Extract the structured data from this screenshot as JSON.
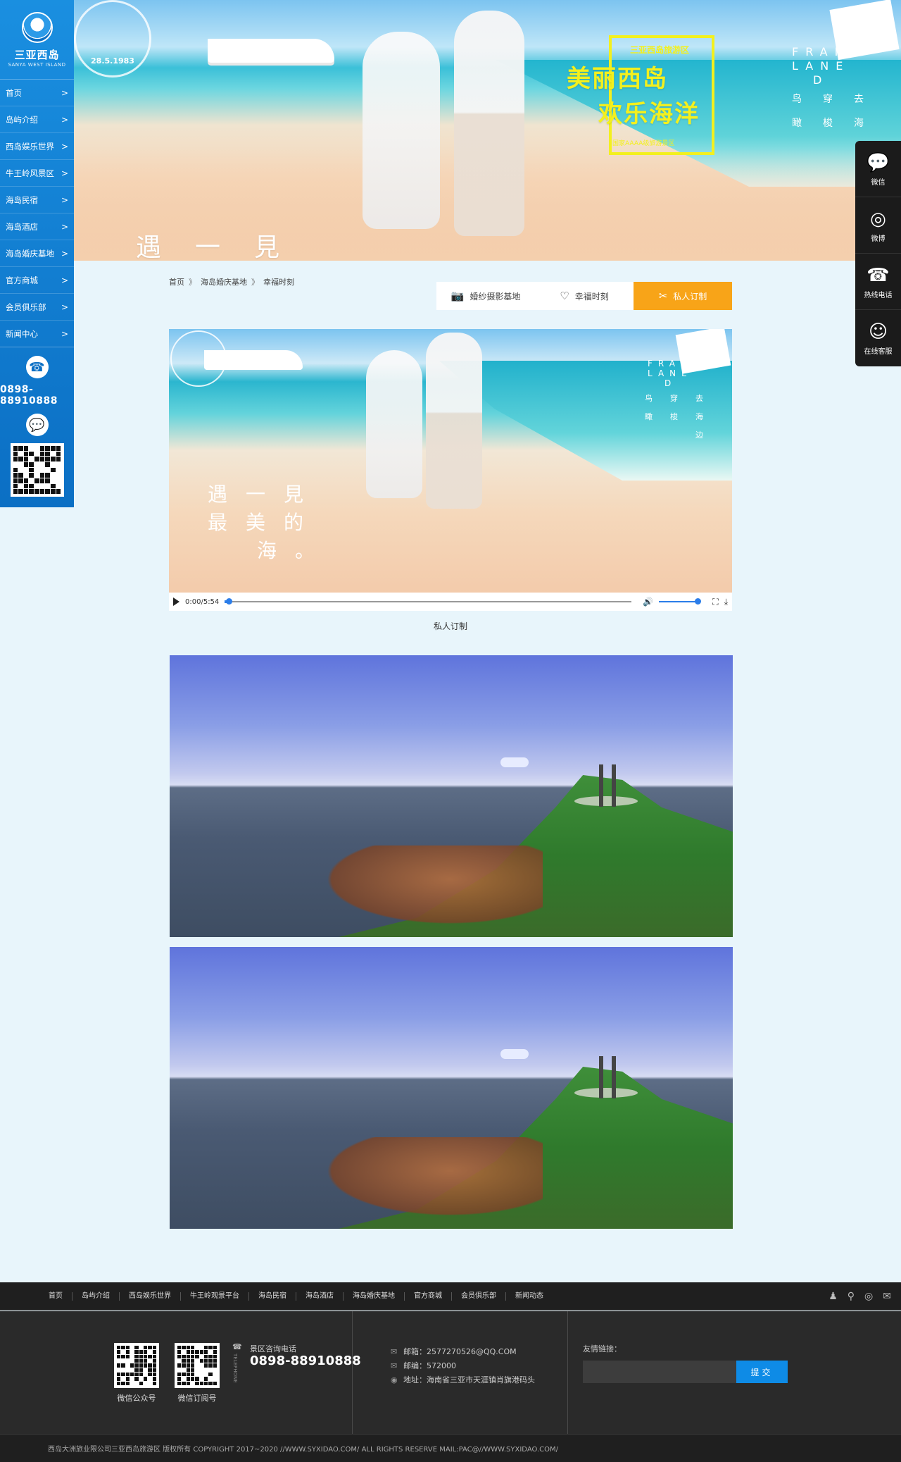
{
  "sidebar": {
    "logo_cn": "三亚西岛",
    "logo_en": "SANYA WEST ISLAND",
    "items": [
      {
        "label": "首页"
      },
      {
        "label": "岛屿介绍"
      },
      {
        "label": "西岛娱乐世界"
      },
      {
        "label": "牛王岭风景区"
      },
      {
        "label": "海岛民宿"
      },
      {
        "label": "海岛酒店"
      },
      {
        "label": "海岛婚庆基地"
      },
      {
        "label": "官方商城"
      },
      {
        "label": "会员俱乐部"
      },
      {
        "label": "新闻中心"
      }
    ],
    "arrow": ">",
    "phone": "0898-88910888"
  },
  "banner": {
    "stamp_date": "28.5.1983",
    "slogan_top": "三亚西岛旅游区",
    "slogan_1": "美丽西岛",
    "slogan_2": "欢乐海洋",
    "slogan_sub": "国家AAAA级旅游景区",
    "frank": [
      "FRANK",
      "LANE",
      "D"
    ],
    "frank_cn": [
      "鸟",
      "穿",
      "去",
      "瞰",
      "梭",
      "海"
    ],
    "meet": "遇一見"
  },
  "float_contact": {
    "items": [
      {
        "icon": "wechat-icon",
        "glyph": "💬",
        "label": "微信"
      },
      {
        "icon": "weibo-icon",
        "glyph": "◎",
        "label": "微博"
      },
      {
        "icon": "phone-icon",
        "glyph": "☎",
        "label": "热线电话"
      },
      {
        "icon": "service-icon",
        "glyph": "☺",
        "label": "在线客服"
      }
    ]
  },
  "breadcrumb": {
    "items": [
      "首页",
      "海岛婚庆基地",
      "幸福时刻"
    ],
    "sep": "》"
  },
  "tabs": [
    {
      "icon": "camera-icon",
      "glyph": "📷",
      "label": "婚纱摄影基地",
      "active": false
    },
    {
      "icon": "heart-icon",
      "glyph": "♡",
      "label": "幸福时刻",
      "active": false
    },
    {
      "icon": "scissors-icon",
      "glyph": "✂",
      "label": "私人订制",
      "active": true
    }
  ],
  "video": {
    "time": "0:00/5:54",
    "progress": 0.01,
    "volume": 1.0,
    "frank": [
      "FRANK",
      "LANE",
      "D"
    ],
    "frank_cn": [
      "鸟",
      "穿",
      "去",
      "瞰",
      "梭",
      "海",
      "",
      "",
      "边"
    ],
    "meet_lines": [
      "遇一見",
      "最美的",
      "海。"
    ],
    "caption": "私人订制"
  },
  "footer": {
    "nav": [
      "首页",
      "岛屿介绍",
      "西岛娱乐世界",
      "牛王岭观景平台",
      "海岛民宿",
      "海岛酒店",
      "海岛婚庆基地",
      "官方商城",
      "会员俱乐部",
      "新闻动态"
    ],
    "social": [
      {
        "icon": "qq-icon",
        "glyph": "♟"
      },
      {
        "icon": "location-icon",
        "glyph": "⚲"
      },
      {
        "icon": "weibo-icon",
        "glyph": "◎"
      },
      {
        "icon": "wechat-icon",
        "glyph": "✉"
      }
    ],
    "qr1_label": "微信公众号",
    "qr2_label": "微信订阅号",
    "tel_vert": "TELEPHONE",
    "tel_label": "景区咨询电话",
    "tel_num": "0898-88910888",
    "email": "邮箱：2577270526@QQ.COM",
    "postcode": "邮编：572000",
    "address": "地址：海南省三亚市天涯镇肖旗港码头",
    "links_label": "友情链接：",
    "submit": "提交",
    "copyright": "西岛大洲旅业限公司三亚西岛旅游区 版权所有 COPYRIGHT     2017~2020 //WWW.SYXIDAO.COM/ ALL RIGHTS RESERVE MAIL:PAC@//WWW.SYXIDAO.COM/"
  },
  "colors": {
    "sidebar": "#0b6fc4",
    "accent": "#f8a418",
    "slogan": "#f3f01e",
    "footer": "#2a2a2a",
    "submit": "#0e8be6"
  }
}
